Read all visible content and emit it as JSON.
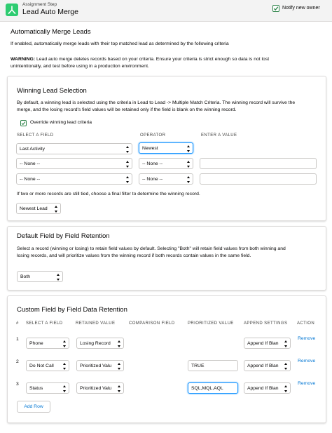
{
  "header": {
    "subtitle": "Assignment Step",
    "title": "Lead Auto Merge",
    "notify_label": "Notify new owner",
    "notify_checked": true
  },
  "intro": {
    "title": "Automatically Merge Leads",
    "description": "If enabled, automatically merge leads with their top matched lead as determined by the following criteria",
    "warning_label": "WARNING:",
    "warning_line1": " Lead auto merge deletes records based on your criteria. Ensure your criteria is strict enough so data is not lost",
    "warning_line2": "unintentionally, and test before using in a production environment."
  },
  "winning": {
    "title": "Winning Lead Selection",
    "desc_line1": "By default, a winning lead is selected using the criteria in Lead to Lead -> Multiple Match Criteria. The winning record will survive the",
    "desc_line2": "merge, and the losing record's field values will be retained only if the field is blank on the winning record.",
    "override_label": "Override winning lead criteria",
    "col_field": "Select a Field",
    "col_operator": "Operator",
    "col_value": "Enter a Value",
    "rows": [
      {
        "field": "Last Activity",
        "operator": "Newest",
        "value": ""
      },
      {
        "field": "-- None --",
        "operator": "-- None --",
        "value": ""
      },
      {
        "field": "-- None --",
        "operator": "-- None --",
        "value": ""
      }
    ],
    "tie_text": "If two or more records are still tied, choose a final filter to determine the winning record.",
    "tie_value": "Newest Lead"
  },
  "default_retention": {
    "title": "Default Field by Field Retention",
    "desc_line1": "Select a record (winning or losing) to retain field values by default. Selecting \"Both\" will retain field values from both winning and",
    "desc_line2": "losing records, and will prioritize values from the winning record if both records contain values in the same field.",
    "value": "Both"
  },
  "custom_retention": {
    "title": "Custom Field by Field Data Retention",
    "col_num": "#",
    "col_field": "Select a Field",
    "col_retained": "Retained Value",
    "col_comparison": "Comparison Field",
    "col_prioritized": "Prioritized Value",
    "col_append": "Append Settings",
    "col_action": "Action",
    "rows": [
      {
        "num": "1",
        "field": "Phone",
        "retained": "Losing Record",
        "prioritized": "",
        "append": "Append If Blan",
        "action": "Remove"
      },
      {
        "num": "2",
        "field": "Do Not Call",
        "retained": "Prioritized Valu",
        "prioritized": "TRUE",
        "append": "Append If Blan",
        "action": "Remove"
      },
      {
        "num": "3",
        "field": "Status",
        "retained": "Prioritized Valu",
        "prioritized": "SQL,MQL,AQL",
        "append": "Append If Blan",
        "action": "Remove"
      }
    ],
    "add_row": "Add Row"
  },
  "colors": {
    "accent": "#0176d3",
    "brand_green": "#2ecc71",
    "check_green": "#2e844a",
    "focus": "#1b96ff"
  }
}
